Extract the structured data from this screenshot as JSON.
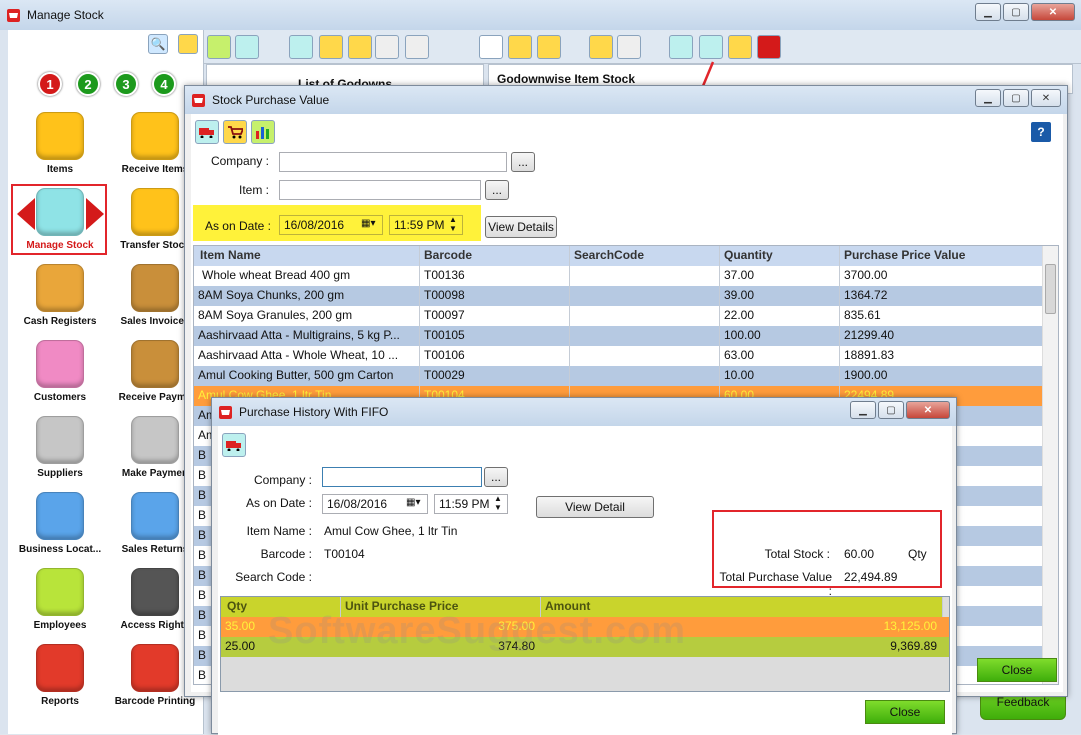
{
  "main": {
    "title": "Manage Stock",
    "numbers": [
      "1",
      "2",
      "3",
      "4"
    ],
    "sidebar": [
      {
        "label": "Items"
      },
      {
        "label": "Receive Items"
      },
      {
        "label": "Manage Stock"
      },
      {
        "label": "Transfer Stock"
      },
      {
        "label": "Cash Registers"
      },
      {
        "label": "Sales Invoices"
      },
      {
        "label": "Customers"
      },
      {
        "label": "Receive Payme"
      },
      {
        "label": "Suppliers"
      },
      {
        "label": "Make Paymen"
      },
      {
        "label": "Business Locat..."
      },
      {
        "label": "Sales Returns"
      },
      {
        "label": "Employees"
      },
      {
        "label": "Access Rights"
      },
      {
        "label": "Reports"
      },
      {
        "label": "Barcode Printing"
      }
    ],
    "godowns_title": "List of Godowns",
    "godownwise_title": "Godownwise Item Stock",
    "feedback_label": "Feedback"
  },
  "spv": {
    "title": "Stock Purchase Value",
    "company_label": "Company :",
    "item_label": "Item :",
    "as_on_label": "As on Date :",
    "date": "16/08/2016",
    "time": "11:59 PM",
    "view_details": "View Details",
    "browse": "...",
    "help": "?",
    "close": "Close",
    "columns": [
      "Item Name",
      "Barcode",
      "SearchCode",
      "Quantity",
      "Purchase Price Value"
    ],
    "rows": [
      [
        "Whole wheat Bread 400 gm",
        "T00136",
        "",
        "37.00",
        "3700.00"
      ],
      [
        "8AM Soya Chunks, 200 gm",
        "T00098",
        "",
        "39.00",
        "1364.72"
      ],
      [
        "8AM Soya Granules, 200 gm",
        "T00097",
        "",
        "22.00",
        "835.61"
      ],
      [
        "Aashirvaad Atta - Multigrains, 5 kg P...",
        "T00105",
        "",
        "100.00",
        "21299.40"
      ],
      [
        "Aashirvaad Atta - Whole Wheat, 10 ...",
        "T00106",
        "",
        "63.00",
        "18891.83"
      ],
      [
        "Amul Cooking Butter, 500 gm Carton",
        "T00029",
        "",
        "10.00",
        "1900.00"
      ],
      [
        "Amul Cow Ghee, 1 ltr Tin",
        "T00104",
        "",
        "60.00",
        "22494.89"
      ]
    ],
    "partial_rows": [
      "Am",
      "Am",
      "B",
      "B",
      "B",
      "B",
      "B",
      "B",
      "B",
      "B",
      "B",
      "B",
      "B",
      "B"
    ]
  },
  "fifo": {
    "title": "Purchase History With FIFO",
    "company_label": "Company :",
    "company_value": "",
    "as_on_label": "As on Date :",
    "date": "16/08/2016",
    "time": "11:59 PM",
    "view_detail": "View Detail",
    "item_name_label": "Item Name :",
    "item_name": "Amul Cow Ghee, 1 ltr Tin",
    "barcode_label": "Barcode :",
    "barcode": "T00104",
    "search_code_label": "Search Code :",
    "total_stock_label": "Total Stock :",
    "total_stock": "60.00",
    "qty_unit": "Qty",
    "total_pv_label": "Total  Purchase Value :",
    "total_pv": "22,494.89",
    "browse": "...",
    "close": "Close",
    "columns": [
      "Qty",
      "Unit Purchase Price",
      "Amount"
    ],
    "rows": [
      [
        "35.00",
        "375.00",
        "13,125.00"
      ],
      [
        "25.00",
        "374.80",
        "9,369.89"
      ]
    ]
  },
  "watermark": "SoftwareSuggest.com",
  "colors": {
    "highlight": "#fff23a",
    "selected_row": "#ff9c3c",
    "fifo_row2": "#b6cc3f",
    "grid_header": "#c8d8ef",
    "fifo_header": "#c9d42c",
    "annotation": "#e2252b"
  }
}
